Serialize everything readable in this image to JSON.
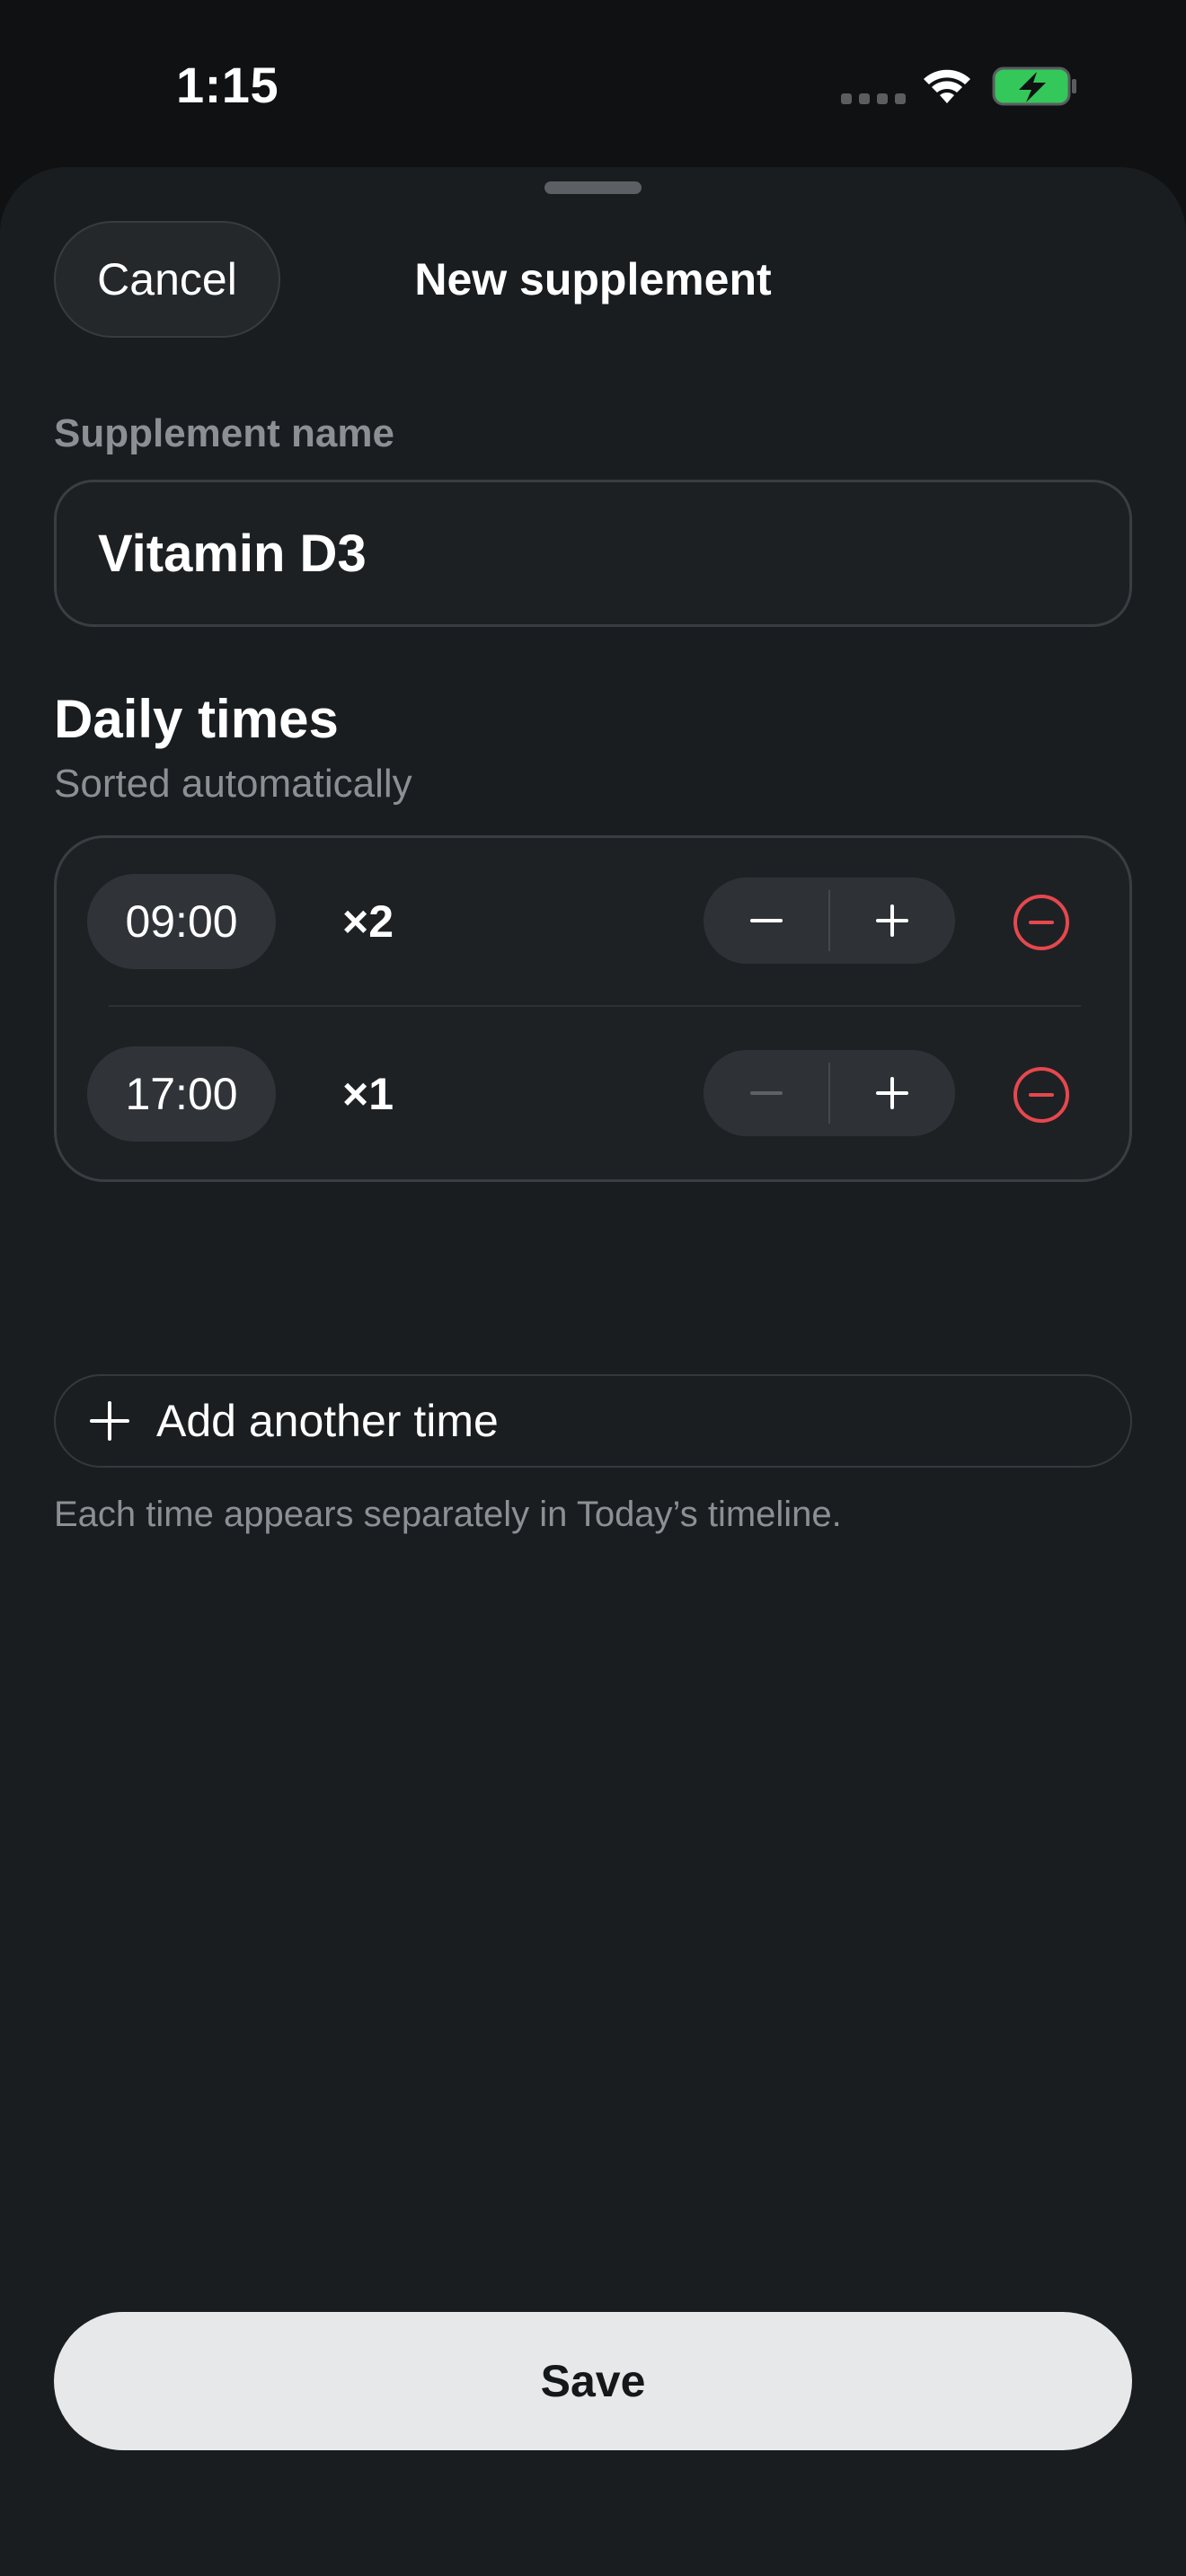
{
  "status_bar": {
    "time": "1:15",
    "icons": [
      "signal-dots-icon",
      "wifi-icon",
      "battery-charging-icon"
    ],
    "battery_color": "#34c759"
  },
  "header": {
    "cancel_label": "Cancel",
    "title": "New supplement"
  },
  "name_field": {
    "label": "Supplement name",
    "value": "Vitamin D3"
  },
  "daily_times": {
    "title": "Daily times",
    "subtitle": "Sorted automatically",
    "rows": [
      {
        "time": "09:00",
        "dose": "×2",
        "minus_enabled": true
      },
      {
        "time": "17:00",
        "dose": "×1",
        "minus_enabled": false
      }
    ],
    "add_label": "Add another time",
    "helper": "Each time appears separately in Today’s timeline."
  },
  "footer": {
    "save_label": "Save"
  },
  "colors": {
    "background": "#1a1d20",
    "remove_red": "#e5484d",
    "save_bg": "#e6e8ea"
  }
}
